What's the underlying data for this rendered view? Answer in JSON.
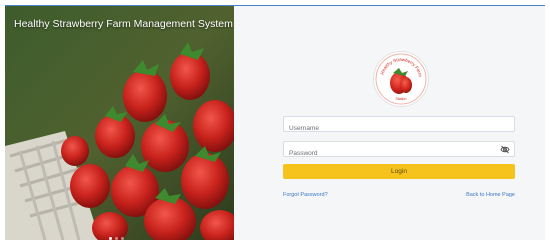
{
  "hero": {
    "title": "Healthy Strawberry Farm Management System",
    "carousel_slides": 3,
    "active_slide": 1
  },
  "logo": {
    "arc_text": "Healthy Strawberry Farm",
    "bottom_text": "Station"
  },
  "login": {
    "username_placeholder": "Username",
    "password_placeholder": "Password",
    "login_label": "Login",
    "forgot_label": "Forgot Password?",
    "back_label": "Back to Home Page"
  },
  "colors": {
    "accent": "#f6c21c",
    "link": "#3a78c8",
    "panel_bg": "#f4f6f8",
    "top_line": "#4a82c8"
  },
  "icons": {
    "password_toggle": "eye-slash-icon"
  }
}
